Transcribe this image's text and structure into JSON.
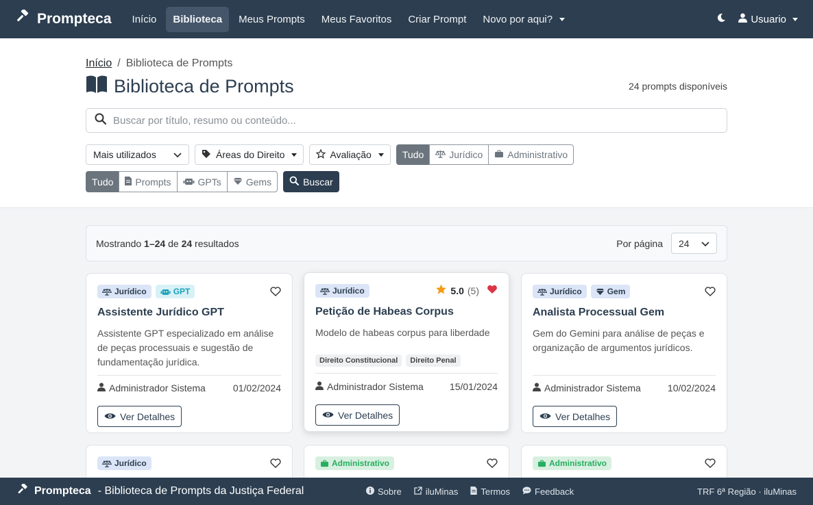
{
  "navbar": {
    "brand": "Prompteca",
    "links": [
      {
        "label": "Início"
      },
      {
        "label": "Biblioteca"
      },
      {
        "label": "Meus Prompts"
      },
      {
        "label": "Meus Favoritos"
      },
      {
        "label": "Criar Prompt"
      },
      {
        "label": "Novo por aqui?"
      }
    ],
    "user": "Usuario"
  },
  "breadcrumb": {
    "home": "Início",
    "separator": "/",
    "current": "Biblioteca de Prompts"
  },
  "page": {
    "title": "Biblioteca de Prompts",
    "count": "24 prompts disponíveis"
  },
  "search": {
    "placeholder": "Buscar por título, resumo ou conteúdo..."
  },
  "filters": {
    "sort": "Mais utilizados",
    "areas": "Áreas do Direito",
    "rating": "Avaliação",
    "scope": [
      "Tudo",
      "Jurídico",
      "Administrativo"
    ],
    "types": [
      "Tudo",
      "Prompts",
      "GPTs",
      "Gems"
    ],
    "search_button": "Buscar"
  },
  "results": {
    "prefix": "Mostrando",
    "range": "1–24",
    "of": "de",
    "total": "24",
    "suffix": "resultados",
    "per_page_label": "Por página",
    "per_page_value": "24"
  },
  "cards": [
    {
      "badges": [
        "Jurídico",
        "GPT"
      ],
      "title": "Assistente Jurídico GPT",
      "description": "Assistente GPT especializado em análise de peças processuais e sugestão de fundamentação jurídica.",
      "author": "Administrador Sistema",
      "date": "01/02/2024",
      "button": "Ver Detalhes"
    },
    {
      "badges": [
        "Jurídico"
      ],
      "rating": "5.0",
      "rating_count": "(5)",
      "title": "Petição de Habeas Corpus",
      "description": "Modelo de habeas corpus para liberdade",
      "tags": [
        "Direito Constitucional",
        "Direito Penal"
      ],
      "author": "Administrador Sistema",
      "date": "15/01/2024",
      "button": "Ver Detalhes"
    },
    {
      "badges": [
        "Jurídico",
        "Gem"
      ],
      "title": "Analista Processual Gem",
      "description": "Gem do Gemini para análise de peças e organização de argumentos jurídicos.",
      "author": "Administrador Sistema",
      "date": "10/02/2024",
      "button": "Ver Detalhes"
    },
    {
      "badges": [
        "Jurídico"
      ]
    },
    {
      "badges": [
        "Administrativo"
      ]
    },
    {
      "badges": [
        "Administrativo"
      ]
    }
  ],
  "footer": {
    "brand": "Prompteca",
    "tagline": "- Biblioteca de Prompts da Justiça Federal",
    "links": [
      "Sobre",
      "iluMinas",
      "Termos",
      "Feedback"
    ],
    "right": "TRF 6ª Região · iluMinas"
  },
  "colors": {
    "primary": "#2c3e50",
    "gpt": "#17a2b8",
    "admin": "#27ae60",
    "heart": "#dc3545",
    "star": "#f39c12"
  }
}
